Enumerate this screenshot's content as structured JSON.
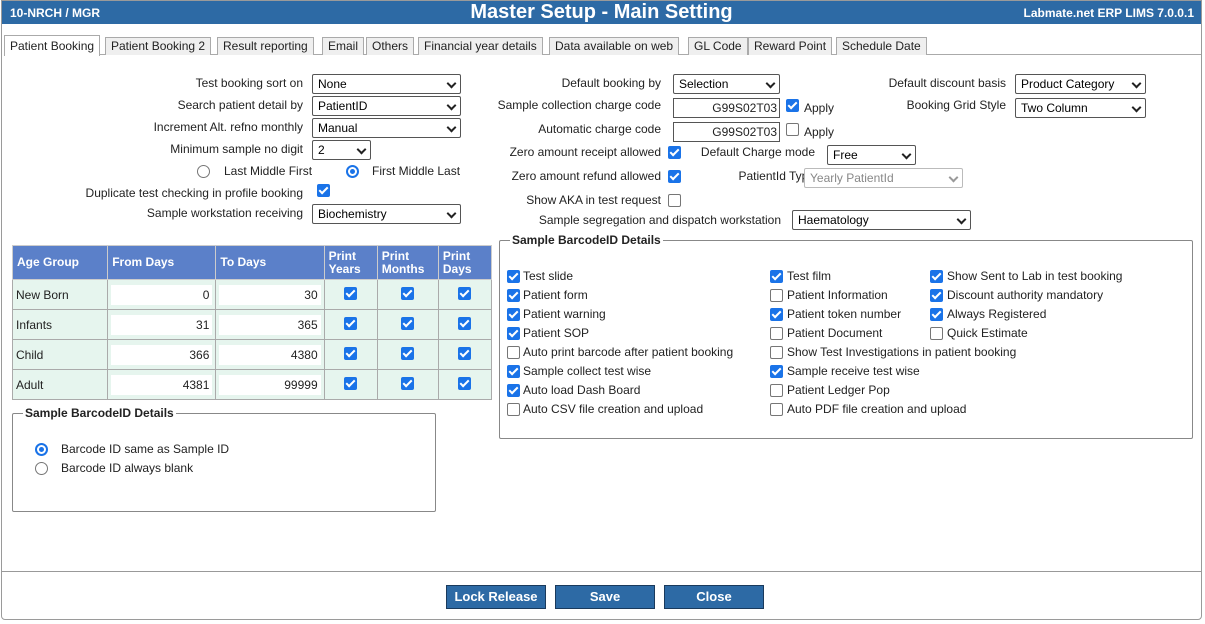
{
  "title_bar": {
    "left": "10-NRCH / MGR",
    "title": "Master Setup - Main Setting",
    "right": "Labmate.net ERP LIMS 7.0.0.1"
  },
  "tabs": [
    "Patient Booking",
    "Patient Booking 2",
    "Result reporting",
    "Email",
    "Others",
    "Financial year details",
    "Data available on web",
    "GL Code",
    "Reward Point",
    "Schedule Date"
  ],
  "left_settings": {
    "test_booking_sort_on": {
      "label": "Test booking sort on",
      "value": "None"
    },
    "search_patient_detail_by": {
      "label": "Search patient detail by",
      "value": "PatientID"
    },
    "increment_alt_refno": {
      "label": "Increment Alt. refno monthly",
      "value": "Manual"
    },
    "min_sample_no_digit": {
      "label": "Minimum sample no digit",
      "value": "2"
    },
    "name_order_1": "Last Middle First",
    "name_order_2": "First Middle Last",
    "duplicate_test_checking": "Duplicate test checking in profile booking",
    "sample_workstation_receiving": {
      "label": "Sample workstation receiving",
      "value": "Biochemistry"
    }
  },
  "mid_settings": {
    "default_booking_by": {
      "label": "Default booking by",
      "value": "Selection"
    },
    "sample_collection_charge_code": {
      "label": "Sample collection charge code",
      "value": "G99S02T03",
      "apply": "Apply"
    },
    "automatic_charge_code": {
      "label": "Automatic charge code",
      "value": "G99S02T03",
      "apply": "Apply"
    },
    "zero_amount_receipt": "Zero amount receipt allowed",
    "zero_amount_refund": "Zero amount refund allowed",
    "show_aka": "Show AKA in test request",
    "default_charge_mode": {
      "label": "Default Charge mode",
      "value": "Free"
    },
    "patientid_type": {
      "label": "PatientId Type",
      "value": "Yearly PatientId"
    },
    "sample_segregation": {
      "label": "Sample segregation and dispatch workstation",
      "value": "Haematology"
    }
  },
  "right_settings": {
    "default_discount_basis": {
      "label": "Default discount basis",
      "value": "Product Category"
    },
    "booking_grid_style": {
      "label": "Booking Grid Style",
      "value": "Two Column"
    }
  },
  "age_table": {
    "headers": [
      "Age Group",
      "From Days",
      "To Days",
      "Print Years",
      "Print Months",
      "Print Days"
    ],
    "rows": [
      {
        "group": "New Born",
        "from": "0",
        "to": "30"
      },
      {
        "group": "Infants",
        "from": "31",
        "to": "365"
      },
      {
        "group": "Child",
        "from": "366",
        "to": "4380"
      },
      {
        "group": "Adult",
        "from": "4381",
        "to": "99999"
      }
    ]
  },
  "barcode_left": {
    "legend": "Sample BarcodeID Details",
    "option1": "Barcode ID same as Sample ID",
    "option2": "Barcode ID always blank"
  },
  "barcode_right": {
    "legend": "Sample BarcodeID Details",
    "col1": [
      {
        "label": "Test slide",
        "checked": true
      },
      {
        "label": "Patient form",
        "checked": true
      },
      {
        "label": "Patient warning",
        "checked": true
      },
      {
        "label": "Patient SOP",
        "checked": true
      },
      {
        "label": "Auto print barcode after patient booking",
        "checked": false
      },
      {
        "label": "Sample collect test wise",
        "checked": true
      },
      {
        "label": "Auto load Dash Board",
        "checked": true
      },
      {
        "label": "Auto CSV file creation and upload",
        "checked": false
      }
    ],
    "col2": [
      {
        "label": "Test film",
        "checked": true
      },
      {
        "label": "Patient Information",
        "checked": false
      },
      {
        "label": "Patient token number",
        "checked": true
      },
      {
        "label": "Patient Document",
        "checked": false
      },
      {
        "label": "Show Test Investigations in patient booking",
        "checked": false
      },
      {
        "label": "Sample receive test wise",
        "checked": true
      },
      {
        "label": "Patient Ledger Pop",
        "checked": false
      },
      {
        "label": "Auto PDF file creation and upload",
        "checked": false
      }
    ],
    "col3": [
      {
        "label": "Show Sent to Lab in test booking",
        "checked": true
      },
      {
        "label": "Discount authority mandatory",
        "checked": true
      },
      {
        "label": "Always Registered",
        "checked": true
      },
      {
        "label": "Quick Estimate",
        "checked": false
      }
    ]
  },
  "buttons": {
    "lock_release": "Lock Release",
    "save": "Save",
    "close": "Close"
  },
  "colors": {
    "title_bar": "#2d6aa5",
    "table_header": "#5b80c9",
    "table_row": "#e6f5ee",
    "checkbox": "#1a73e8"
  }
}
